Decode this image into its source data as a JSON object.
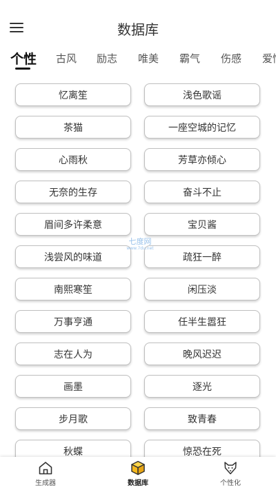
{
  "header": {
    "title": "数据库",
    "menu_icon": "hamburger-menu-icon"
  },
  "tabs": [
    {
      "label": "个性",
      "active": true
    },
    {
      "label": "古风"
    },
    {
      "label": "励志"
    },
    {
      "label": "唯美"
    },
    {
      "label": "霸气"
    },
    {
      "label": "伤感"
    },
    {
      "label": "爱情"
    }
  ],
  "items": [
    "忆离笙",
    "浅色歌谣",
    "茶猫",
    "一座空城的记忆",
    "心雨秋",
    "芳草亦倾心",
    "无奈的生存",
    "奋斗不止",
    "眉间多许柔意",
    "宝贝酱",
    "浅尝风的味道",
    "疏狂一醉",
    "南熙寒笙",
    "闲压淡",
    "万事亨通",
    "任半生嚣狂",
    "志在人为",
    "晚风迟迟",
    "画墨",
    "逐光",
    "步月歌",
    "致青春",
    "秋蝶",
    "惊恐在死"
  ],
  "watermark": {
    "line1": "七度网",
    "line2": "www.7du.net"
  },
  "bottom_nav": [
    {
      "label": "生成器",
      "icon": "home-icon"
    },
    {
      "label": "数据库",
      "icon": "cube-icon",
      "active": true
    },
    {
      "label": "个性化",
      "icon": "fox-icon"
    }
  ],
  "colors": {
    "accent_active_icon": "#f5b81e",
    "border": "#bfbfbf"
  }
}
